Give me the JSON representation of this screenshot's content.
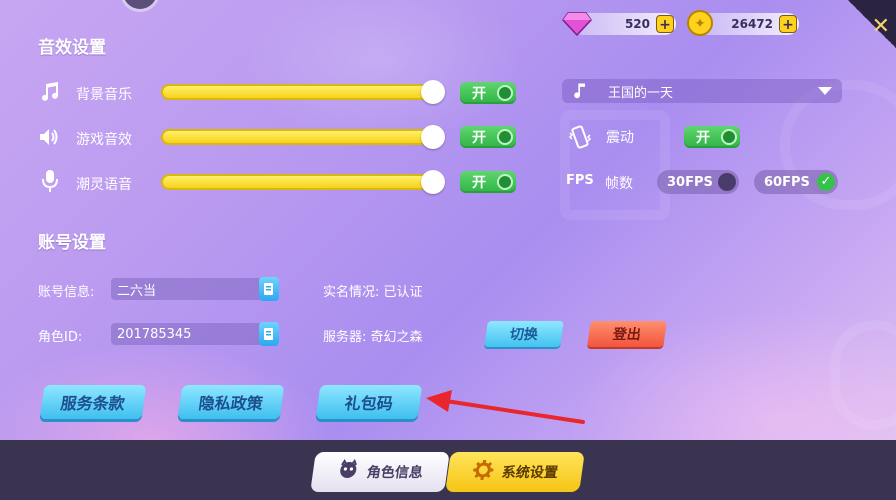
{
  "currency": {
    "gems": "520",
    "coins": "26472"
  },
  "audio": {
    "title": "音效设置",
    "rows": [
      {
        "label": "背景音乐",
        "toggle": "开",
        "level": 1.0
      },
      {
        "label": "游戏音效",
        "toggle": "开",
        "level": 1.0
      },
      {
        "label": "潮灵语音",
        "toggle": "开",
        "level": 1.0
      }
    ],
    "music_select": "王国的一天",
    "vibration": {
      "label": "震动",
      "toggle": "开"
    },
    "fps": {
      "icon_label": "FPS",
      "label": "帧数",
      "option_30": "30FPS",
      "option_60": "60FPS",
      "selected": "60FPS"
    }
  },
  "account": {
    "title": "账号设置",
    "info_label": "账号信息:",
    "info_value": "二六当",
    "role_label": "角色ID:",
    "role_value": "201785345",
    "realname": "实名情况: 已认证",
    "server": "服务器: 奇幻之森",
    "switch_btn": "切换",
    "logout_btn": "登出"
  },
  "buttons": {
    "terms": "服务条款",
    "privacy": "隐私政策",
    "gift_code": "礼包码"
  },
  "tabs": {
    "character": "角色信息",
    "system": "系统设置"
  },
  "colors": {
    "accent_yellow": "#f6d21a",
    "toggle_green": "#2fb445",
    "button_blue": "#43c3f0",
    "button_red": "#f2553e",
    "annotation_arrow": "#e8262c"
  }
}
